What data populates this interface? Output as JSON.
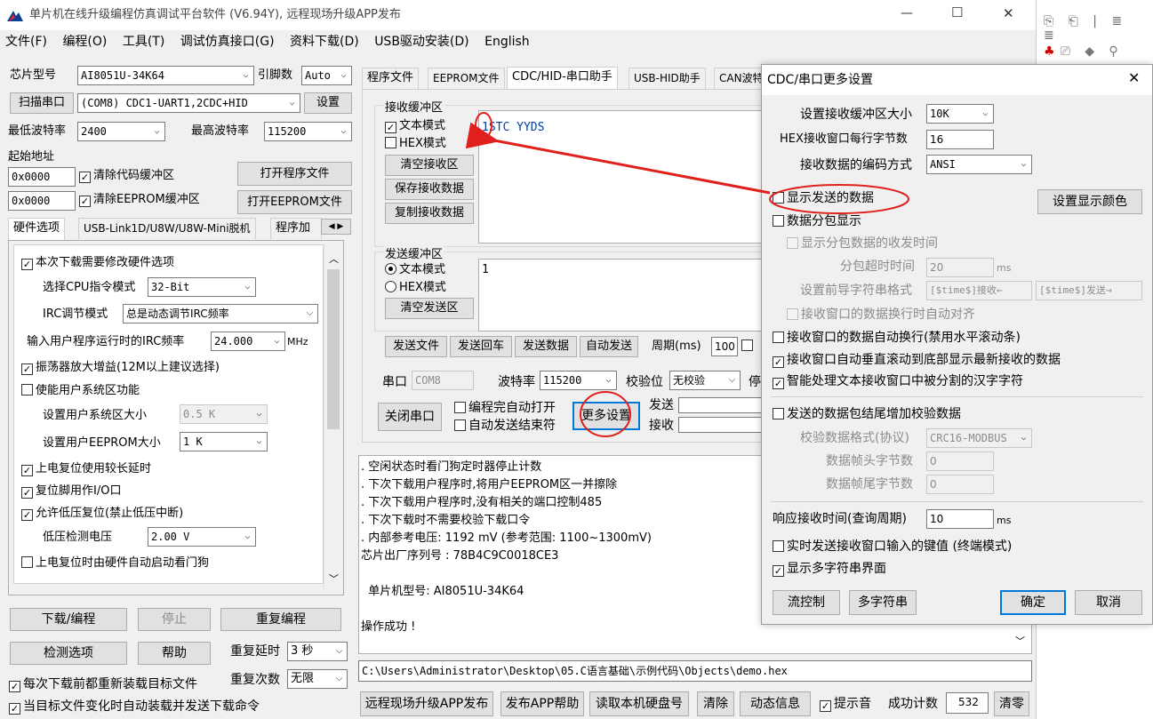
{
  "window": {
    "title": "单片机在线升级编程仿真调试平台软件 (V6.94Y), 远程现场升级APP发布",
    "min": "—",
    "max": "☐",
    "close": "✕"
  },
  "menu": [
    "文件(F)",
    "编程(O)",
    "工具(T)",
    "调试仿真接口(G)",
    "资料下载(D)",
    "USB驱动安装(D)",
    "English"
  ],
  "left": {
    "chip_label": "芯片型号",
    "chip_value": "AI8051U-34K64",
    "pin_label": "引脚数",
    "pin_value": "Auto",
    "scan_btn": "扫描串口",
    "port_value": "(COM8) CDC1-UART1,2CDC+HID",
    "settings_btn": "设置",
    "min_baud_label": "最低波特率",
    "min_baud": "2400",
    "max_baud_label": "最高波特率",
    "max_baud": "115200",
    "start_addr_label": "起始地址",
    "addr1": "0x0000",
    "clear_code": "清除代码缓冲区",
    "open_prog": "打开程序文件",
    "addr2": "0x0000",
    "clear_eeprom": "清除EEPROM缓冲区",
    "open_eeprom": "打开EEPROM文件",
    "tabs": [
      "硬件选项",
      "USB-Link1D/U8W/U8W-Mini脱机",
      "程序加"
    ],
    "hw": {
      "modify": "本次下载需要修改硬件选项",
      "cpu_label": "选择CPU指令模式",
      "cpu_value": "32-Bit",
      "irc_label": "IRC调节模式",
      "irc_value": "总是动态调节IRC频率",
      "freq_label": "输入用户程序运行时的IRC频率",
      "freq_value": "24.000",
      "freq_unit": "MHz",
      "osc": "振荡器放大增益(12M以上建议选择)",
      "sysarea": "使能用户系统区功能",
      "sysarea_size_label": "设置用户系统区大小",
      "sysarea_size": "0.5 K",
      "eeprom_size_label": "设置用户EEPROM大小",
      "eeprom_size": "1   K",
      "long_delay": "上电复位使用较长延时",
      "reset_io": "复位脚用作I/O口",
      "lvr": "允许低压复位(禁止低压中断)",
      "lvd_label": "低压检测电压",
      "lvd_value": "2.00 V",
      "wdt": "上电复位时由硬件自动启动看门狗"
    },
    "download_btn": "下载/编程",
    "stop_btn": "停止",
    "reprog_btn": "重复编程",
    "check_btn": "检测选项",
    "help_btn": "帮助",
    "delay_label": "重复延时",
    "delay_value": "3 秒",
    "count_label": "重复次数",
    "count_value": "无限",
    "reload": "每次下载前都重新装载目标文件",
    "auto_send": "当目标文件变化时自动装载并发送下载命令"
  },
  "center": {
    "tabs": [
      "程序文件",
      "EEPROM文件",
      "CDC/HID-串口助手",
      "USB-HID助手",
      "CAN波特"
    ],
    "recv_title": "接收缓冲区",
    "text_mode": "文本模式",
    "hex_mode": "HEX模式",
    "clear_recv": "清空接收区",
    "save_recv": "保存接收数据",
    "copy_recv": "复制接收数据",
    "recv_content": "1STC YYDS",
    "send_title": "发送缓冲区",
    "send_text_mode": "文本模式",
    "send_hex_mode": "HEX模式",
    "clear_send": "清空发送区",
    "send_content": "1",
    "send_file": "发送文件",
    "send_cr": "发送回车",
    "send_data": "发送数据",
    "auto_send": "自动发送",
    "period_label": "周期(ms)",
    "period_value": "100",
    "port_label": "串口",
    "port_value": "COM8",
    "baud_label": "波特率",
    "baud_value": "115200",
    "parity_label": "校验位",
    "parity_value": "无校验",
    "stop_label": "停",
    "close_port": "关闭串口",
    "auto_open": "编程完自动打开",
    "auto_end": "自动发送结束符",
    "more_settings": "更多设置",
    "tx_label": "发送",
    "rx_label": "接收"
  },
  "log": {
    "lines": [
      ". 空闲状态时看门狗定时器停止计数",
      ". 下次下载用户程序时,将用户EEPROM区一并擦除",
      ". 下次下载用户程序时,没有相关的端口控制485",
      ". 下次下载时不需要校验下载口令",
      ". 内部参考电压: 1192 mV (参考范围: 1100~1300mV)",
      "芯片出厂序列号 : 78B4C9C0018CE3",
      "",
      "  单片机型号: AI8051U-34K64",
      "",
      "操作成功 !"
    ],
    "path": "C:\\Users\\Administrator\\Desktop\\05.C语言基础\\示例代码\\Objects\\demo.hex"
  },
  "bottom": {
    "remote": "远程现场升级APP发布",
    "app_help": "发布APP帮助",
    "read_disk": "读取本机硬盘号",
    "clear": "清除",
    "dyn_info": "动态信息",
    "beep": "提示音",
    "success_label": "成功计数",
    "success_value": "532",
    "zero": "清零"
  },
  "dialog": {
    "title": "CDC/串口更多设置",
    "close": "✕",
    "buf_size_label": "设置接收缓冲区大小",
    "buf_size": "10K",
    "hex_bytes_label": "HEX接收窗口每行字节数",
    "hex_bytes": "16",
    "encoding_label": "接收数据的编码方式",
    "encoding": "ANSI",
    "show_sent": "显示发送的数据",
    "set_color": "设置显示颜色",
    "packet_display": "数据分包显示",
    "packet_time": "显示分包数据的收发时间",
    "packet_timeout_label": "分包超时时间",
    "packet_timeout": "20",
    "ms1": "ms",
    "prefix_label": "设置前导字符串格式",
    "prefix_recv": "[$time$]接收←",
    "prefix_send": "[$time$]发送→",
    "auto_align": "接收窗口的数据换行时自动对齐",
    "auto_wrap": "接收窗口的数据自动换行(禁用水平滚动条)",
    "auto_scroll": "接收窗口自动垂直滚动到底部显示最新接收的数据",
    "smart_cn": "智能处理文本接收窗口中被分割的汉字字符",
    "checksum": "发送的数据包结尾增加校验数据",
    "check_fmt_label": "校验数据格式(协议)",
    "check_fmt": "CRC16-MODBUS",
    "head_bytes_label": "数据帧头字节数",
    "head_bytes": "0",
    "tail_bytes_label": "数据帧尾字节数",
    "tail_bytes": "0",
    "resp_label": "响应接收时间(查询周期)",
    "resp_value": "10",
    "ms2": "ms",
    "realtime": "实时发送接收窗口输入的键值 (终端模式)",
    "multi_str": "显示多字符串界面",
    "flow_btn": "流控制",
    "multi_btn": "多字符串",
    "ok_btn": "确定",
    "cancel_btn": "取消"
  },
  "colors": {
    "accent": "#0078d7",
    "annotation": "#e0201c",
    "title_blue": "#003fa0"
  }
}
